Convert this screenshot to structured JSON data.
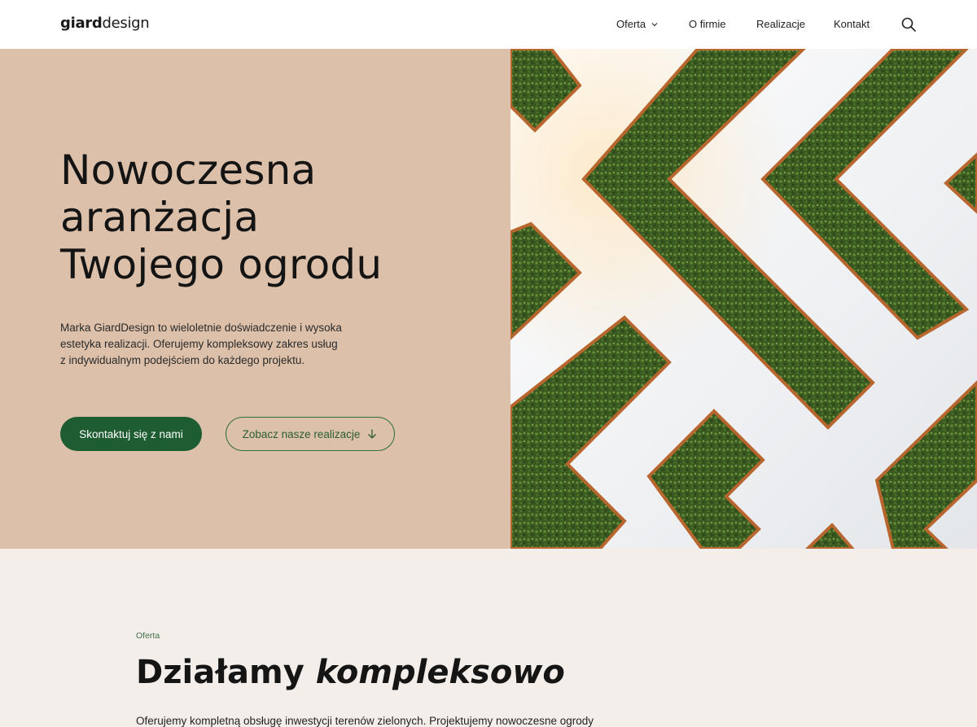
{
  "header": {
    "logo_bold": "giard",
    "logo_light": "design",
    "nav": {
      "oferta": "Oferta",
      "o_firmie": "O firmie",
      "realizacje": "Realizacje",
      "kontakt": "Kontakt"
    },
    "icons": {
      "dropdown": "chevron-down-icon",
      "search": "search-icon"
    }
  },
  "hero": {
    "title_line1": "Nowoczesna",
    "title_line2": "aranżacja",
    "title_line3": "Twojego ogrodu",
    "text_line1": "Marka GiardDesign to wieloletnie doświadczenie i wysoka",
    "text_line2": "estetyka realizacji. Oferujemy kompleksowy zakres usług",
    "text_line3": "z indywidualnym podejściem do każdego projektu.",
    "cta_primary": "Skontaktuj się z nami",
    "cta_secondary": "Zobacz nasze realizacje",
    "cta_secondary_icon": "arrow-down-icon"
  },
  "section": {
    "label": "Oferta",
    "title_regular": "Działamy ",
    "title_italic": "kompleksowo",
    "text": "Oferujemy kompletną obsługę inwestycji terenów zielonych. Projektujemy nowoczesne ogrody"
  },
  "colors": {
    "hero_bg": "#dcc0aa",
    "accent_green": "#1e5c32",
    "section_bg": "#f4eeea",
    "planter_corten": "#b8662e",
    "hedge_green": "#3d5c24"
  }
}
